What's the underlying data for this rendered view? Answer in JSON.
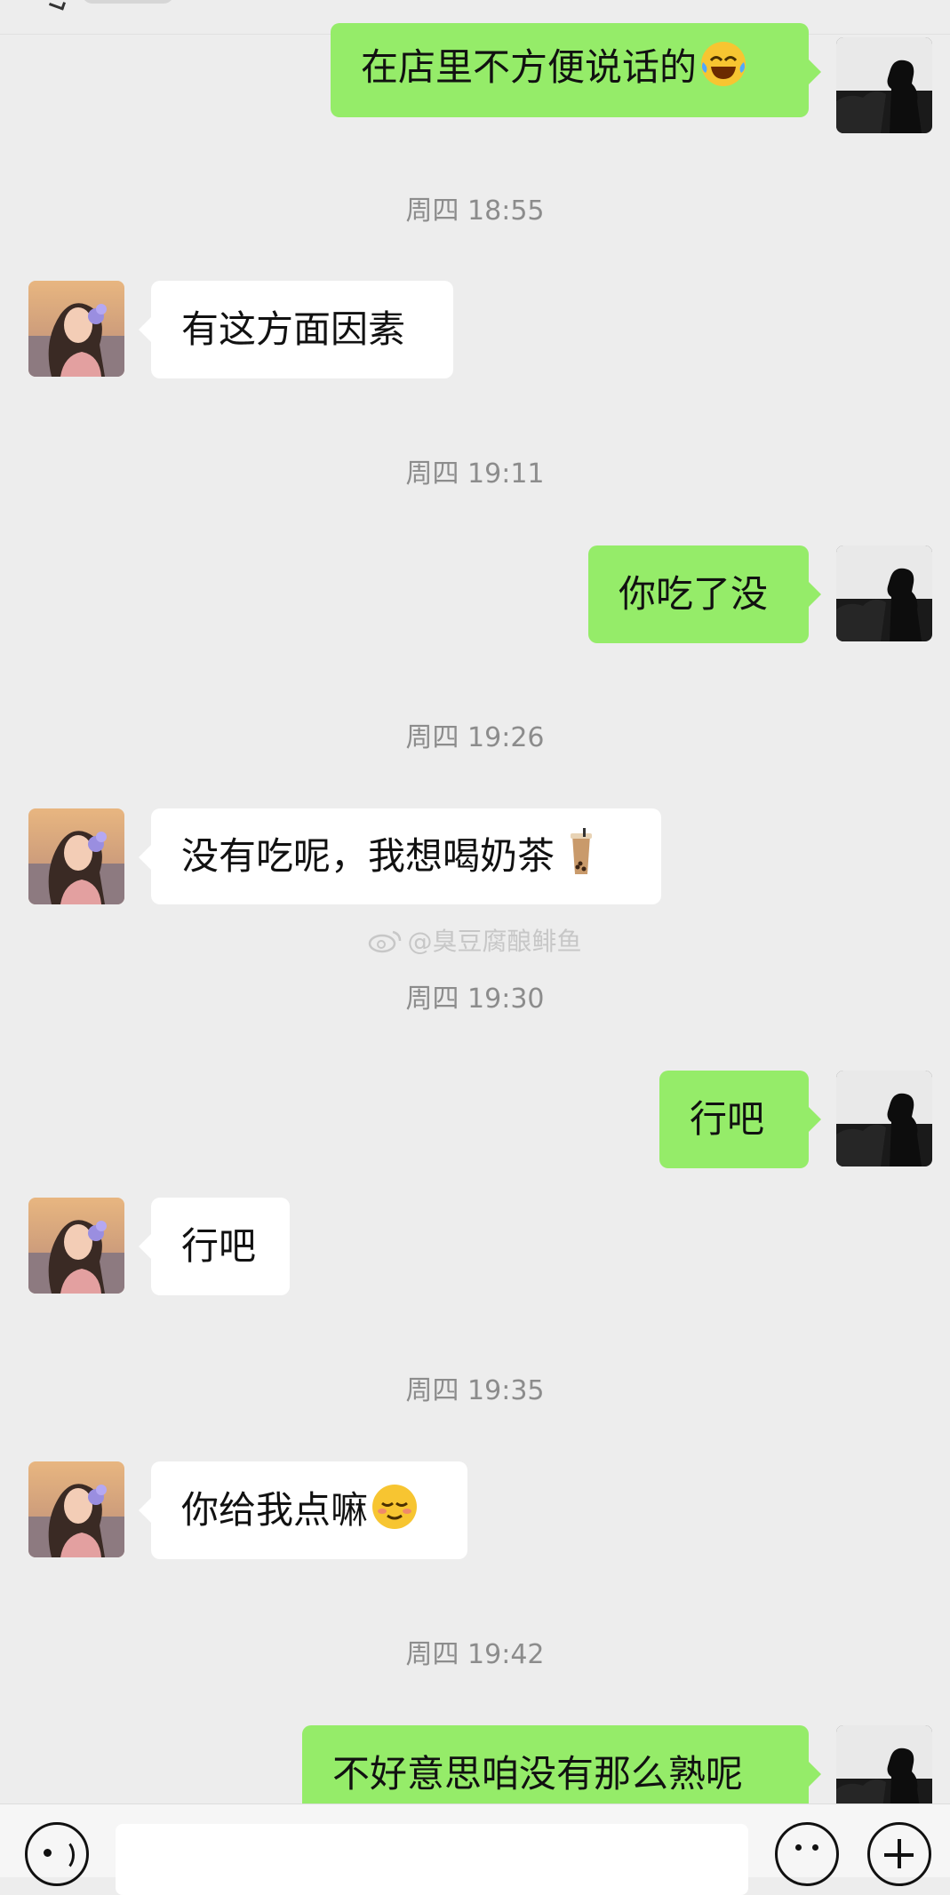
{
  "messages": [
    {
      "from": "me",
      "text": "在店里不方便说话的",
      "emoji": "laughing-tears-emoji"
    },
    {
      "type": "time",
      "text": "周四 18:55"
    },
    {
      "from": "her",
      "text": "有这方面因素"
    },
    {
      "type": "time",
      "text": "周四 19:11"
    },
    {
      "from": "me",
      "text": "你吃了没"
    },
    {
      "type": "time",
      "text": "周四 19:26"
    },
    {
      "from": "her",
      "text": "没有吃呢，我想喝奶茶",
      "emoji": "bubble-tea-emoji"
    },
    {
      "type": "time",
      "text": "周四 19:30"
    },
    {
      "from": "me",
      "text": "行吧"
    },
    {
      "from": "her",
      "text": "行吧"
    },
    {
      "type": "time",
      "text": "周四 19:35"
    },
    {
      "from": "her",
      "text": "你给我点嘛",
      "emoji": "smug-smile-emoji"
    },
    {
      "type": "time",
      "text": "周四 19:42"
    },
    {
      "from": "me",
      "text": "不好意思咱没有那么熟呢"
    }
  ],
  "watermark": "@臭豆腐酿鲱鱼",
  "colors": {
    "background": "#ededed",
    "outgoing_bubble": "#95ec69",
    "incoming_bubble": "#ffffff",
    "timestamp": "#8c8c8c"
  },
  "icons": {
    "voice": "voice-icon",
    "emoji": "emoji-icon",
    "more": "plus-icon"
  }
}
